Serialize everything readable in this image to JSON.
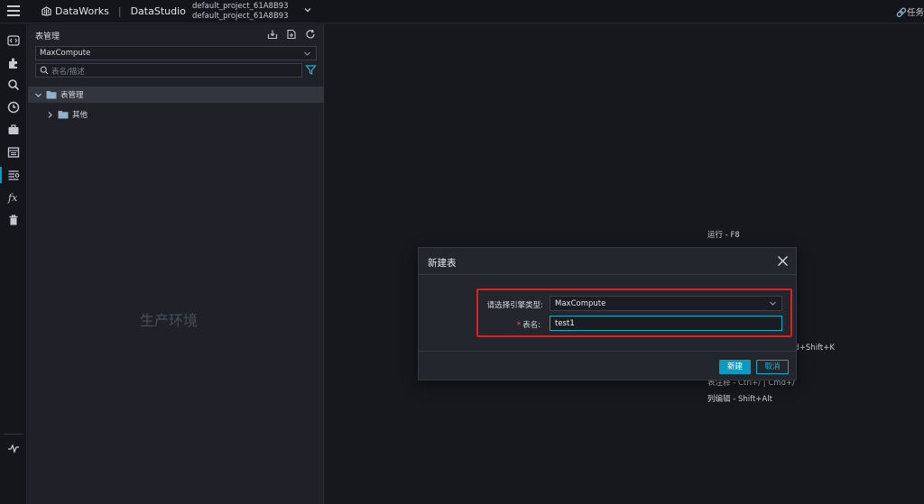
{
  "topbar": {
    "brand": "DataWorks",
    "app": "DataStudio",
    "project_line1": "default_project_61A8B93",
    "project_line2": "default_project_61A8B93",
    "task_link": "任务"
  },
  "panel": {
    "title": "表管理",
    "engine_value": "MaxCompute",
    "search_placeholder": "表名/描述",
    "tree": [
      {
        "label": "表管理",
        "expanded": true
      },
      {
        "label": "其他",
        "expanded": false
      }
    ],
    "watermark": "生产环境"
  },
  "editor_hints": {
    "run": "运行 - F8",
    "frag1": "nd+Shift+K",
    "frag2": "表注释 - Ctrl+/ | Cmd+/",
    "column_edit": "列编辑 - Shift+Alt"
  },
  "modal": {
    "title": "新建表",
    "engine_label": "请选择引擎类型:",
    "engine_value": "MaxCompute",
    "name_label": "表名:",
    "name_required_mark": "*",
    "name_value": "test1",
    "create_label": "新建",
    "cancel_label": "取消"
  },
  "colors": {
    "accent": "#0b9bc2",
    "highlight": "#e02020",
    "panel_bg": "#202128",
    "editor_bg": "#17181e"
  }
}
